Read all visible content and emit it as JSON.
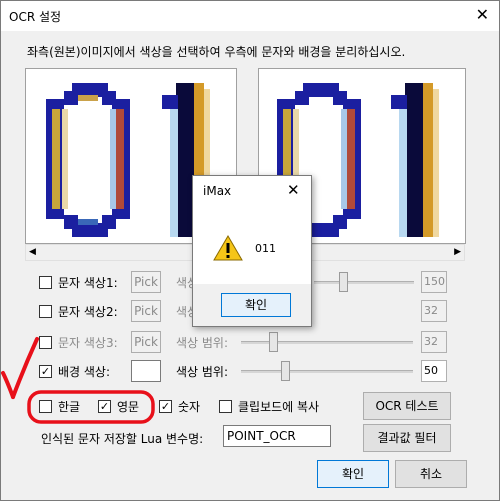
{
  "window": {
    "title": "OCR 설정",
    "close_glyph": "✕",
    "instruction": "좌측(원본)이미지에서 색상을 선택하여 우측에 문자와 배경을 분리하십시오."
  },
  "scroll": {
    "left_arrow": "◀",
    "right_arrow": "▶"
  },
  "color_rows": [
    {
      "label": "문자 색상1:",
      "pick": "Pick",
      "range_label": "색상",
      "value": "150",
      "checked": false,
      "enabled": false
    },
    {
      "label": "문자 색상2:",
      "pick": "Pick",
      "range_label": "색상",
      "value": "32",
      "checked": false,
      "enabled": false
    },
    {
      "label": "문자 색상3:",
      "pick": "Pick",
      "range_label": "색상 범위:",
      "value": "32",
      "checked": false,
      "enabled": false
    },
    {
      "label": "배경 색상:",
      "pick": "",
      "range_label": "색상 범위:",
      "value": "50",
      "checked": true,
      "enabled": true
    }
  ],
  "slider_levels": [
    0.3,
    0.0,
    0.0,
    0.1
  ],
  "options": {
    "korean": {
      "label": "한글",
      "checked": false
    },
    "english": {
      "label": "영문",
      "checked": true
    },
    "digits": {
      "label": "숫자",
      "checked": true
    },
    "clipboard": {
      "label": "클립보드에 복사",
      "checked": false
    },
    "check_glyph": "✓"
  },
  "buttons": {
    "ocr_test": "OCR 테스트",
    "result_filter": "결과값 필터",
    "ok": "확인",
    "cancel": "취소"
  },
  "lua": {
    "label": "인식된 문자 저장할 Lua 변수명:",
    "value": "POINT_OCR"
  },
  "dialog": {
    "title": "iMax",
    "close_glyph": "✕",
    "message": "011",
    "ok": "확인",
    "icon": "warning-icon"
  },
  "colors": {
    "annotation_red": "#e8101a",
    "accent_blue": "#0078d7"
  }
}
